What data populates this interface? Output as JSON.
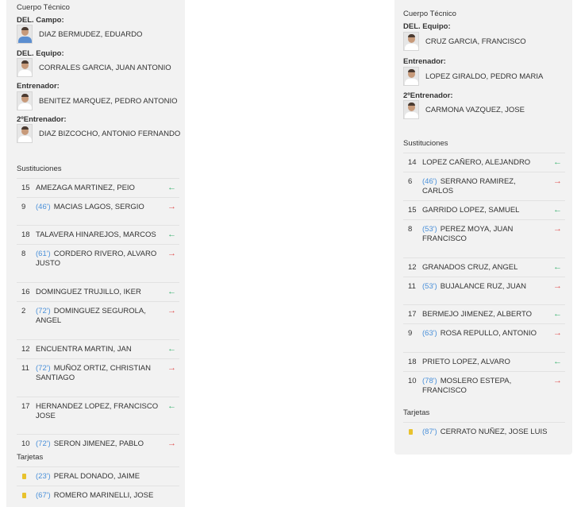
{
  "left": {
    "staff_heading": "Cuerpo Técnico",
    "staff": [
      {
        "role": "DEL. Campo:",
        "name": "DIAZ BERMUDEZ, EDUARDO"
      },
      {
        "role": "DEL. Equipo:",
        "name": "CORRALES GARCIA, JUAN ANTONIO"
      },
      {
        "role": "Entrenador:",
        "name": "BENITEZ MARQUEZ, PEDRO ANTONIO"
      },
      {
        "role": "2ºEntrenador:",
        "name": "DIAZ BIZCOCHO, ANTONIO FERNANDO"
      }
    ],
    "subs_heading": "Sustituciones",
    "subs": [
      {
        "in_num": "15",
        "in_name": "AMEZAGA MARTINEZ, PEIO",
        "out_num": "9",
        "minute": "(46')",
        "out_name": "MACIAS LAGOS, SERGIO"
      },
      {
        "in_num": "18",
        "in_name": "TALAVERA HINAREJOS, MARCOS",
        "out_num": "8",
        "minute": "(61')",
        "out_name": "CORDERO RIVERO, ALVARO JUSTO"
      },
      {
        "in_num": "16",
        "in_name": "DOMINGUEZ TRUJILLO, IKER",
        "out_num": "2",
        "minute": "(72')",
        "out_name": "DOMINGUEZ SEGUROLA, ANGEL"
      },
      {
        "in_num": "12",
        "in_name": "ENCUENTRA MARTIN, JAN",
        "out_num": "11",
        "minute": "(72')",
        "out_name": "MUÑOZ ORTIZ, CHRISTIAN SANTIAGO"
      },
      {
        "in_num": "17",
        "in_name": "HERNANDEZ LOPEZ, FRANCISCO JOSE",
        "out_num": "10",
        "minute": "(72')",
        "out_name": "SERON JIMENEZ, PABLO"
      }
    ],
    "cards_heading": "Tarjetas",
    "cards": [
      {
        "minute": "(23')",
        "name": "PERAL DONADO, JAIME"
      },
      {
        "minute": "(67')",
        "name": "ROMERO MARINELLI, JOSE"
      }
    ]
  },
  "right": {
    "staff_heading": "Cuerpo Técnico",
    "staff": [
      {
        "role": "DEL. Equipo:",
        "name": "CRUZ GARCIA, FRANCISCO"
      },
      {
        "role": "Entrenador:",
        "name": "LOPEZ GIRALDO, PEDRO MARIA"
      },
      {
        "role": "2ºEntrenador:",
        "name": "CARMONA VAZQUEZ, JOSE"
      }
    ],
    "subs_heading": "Sustituciones",
    "subs": [
      {
        "in_num": "14",
        "in_name": "LOPEZ CAÑERO, ALEJANDRO",
        "out_num": "6",
        "minute": "(46')",
        "out_name": "SERRANO RAMIREZ, CARLOS"
      },
      {
        "in_num": "15",
        "in_name": "GARRIDO LOPEZ, SAMUEL",
        "out_num": "8",
        "minute": "(53')",
        "out_name": "PEREZ MOYA, JUAN FRANCISCO"
      },
      {
        "in_num": "12",
        "in_name": "GRANADOS CRUZ, ANGEL",
        "out_num": "11",
        "minute": "(53')",
        "out_name": "BUJALANCE RUZ, JUAN"
      },
      {
        "in_num": "17",
        "in_name": "BERMEJO JIMENEZ, ALBERTO",
        "out_num": "9",
        "minute": "(63')",
        "out_name": "ROSA REPULLO, ANTONIO"
      },
      {
        "in_num": "18",
        "in_name": "PRIETO LOPEZ, ALVARO",
        "out_num": "10",
        "minute": "(78')",
        "out_name": "MOSLERO ESTEPA, FRANCISCO"
      }
    ],
    "cards_heading": "Tarjetas",
    "cards": [
      {
        "minute": "(87')",
        "name": "CERRATO NUÑEZ, JOSE LUIS"
      }
    ]
  },
  "icons": {
    "sub_in": "arrow-left-icon",
    "sub_out": "arrow-right-icon",
    "card": "yellow-card-icon",
    "avatar": "person-photo-icon"
  },
  "colors": {
    "panel_bg": "#f2f2f2",
    "minute_blue": "#4a90d9",
    "sub_in_green": "#3cb371",
    "sub_out_red": "#e05555",
    "card_yellow": "#e8c22d"
  }
}
